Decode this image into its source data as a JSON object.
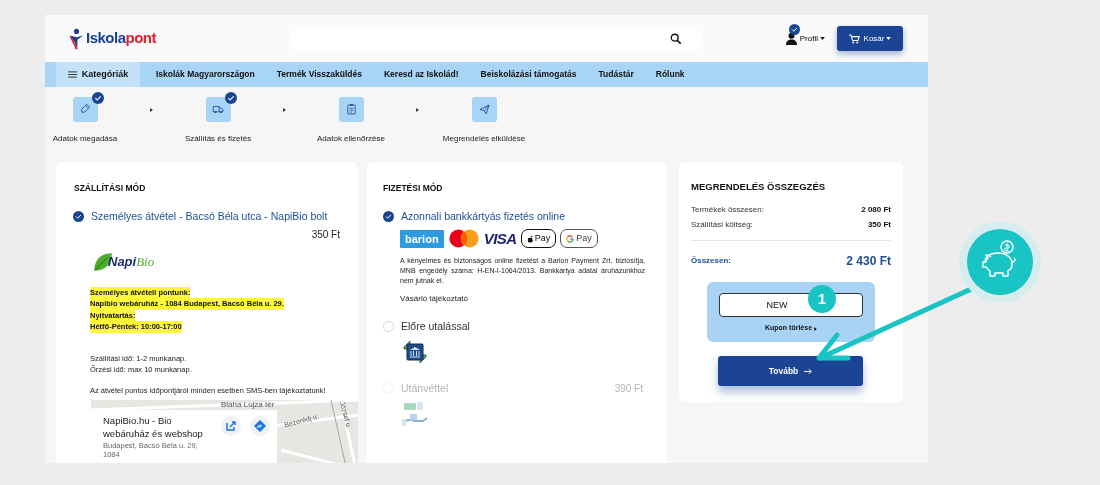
{
  "header": {
    "logo": {
      "first": "Iskola",
      "second": "pont"
    },
    "profile": {
      "label": "Profil",
      "checked": true
    },
    "cart": {
      "label": "Kosár"
    }
  },
  "nav": [
    {
      "label": "Kategóriák",
      "kind": "menu"
    },
    {
      "label": "Iskolák Magyarországon",
      "kind": "link"
    },
    {
      "label": "Termék Visszaküldés",
      "kind": "link"
    },
    {
      "label": "Keresd az Iskolád!",
      "kind": "link"
    },
    {
      "label": "Beiskolázási támogatás",
      "kind": "link"
    },
    {
      "label": "Tudástár",
      "kind": "link"
    },
    {
      "label": "Rólunk",
      "kind": "link"
    }
  ],
  "steps": [
    {
      "label": "Adatok megadása",
      "kind": "edit",
      "done": true
    },
    {
      "label": "Szállítás és fizetés",
      "kind": "truck",
      "done": true
    },
    {
      "label": "Adatok ellenőrzése",
      "kind": "clipboard",
      "done": false
    },
    {
      "label": "Megrendelés elküldése",
      "kind": "send",
      "done": false
    }
  ],
  "shipping": {
    "title": "SZÁLLÍTÁSI MÓD",
    "option": {
      "label": "Személyes átvétel - Bacsó Béla utca - NapiBio bolt",
      "selected": true,
      "price": "350 Ft"
    },
    "store_logo": {
      "first": "Napi",
      "second": "Bio"
    },
    "highlight_lines": [
      "Személyes átvételi pontunk:",
      "Napibio webáruház - 1084 Budapest, Bacsó Béla u. 29.",
      "Nyitvatartás:",
      "Hétfő-Péntek: 10:00-17:00"
    ],
    "info_lines": [
      "Szállítási idő: 1-2 munkanap.",
      "Őrzési idő: max 10 munkanap."
    ],
    "notice": "Az átvétel pontos időpontjáról minden esetben SMS-ben tájékoztatunk!",
    "map": {
      "place_title": "NapiBio.hu - Bio webáruház és webshop",
      "address": "Budapest, Bacsó Béla u. 29, 1084",
      "street_labels": [
        "Blaha Lujza tér",
        "Bezerédj u.",
        "József u."
      ]
    }
  },
  "payment": {
    "title": "FIZETÉSI MÓD",
    "options": [
      {
        "kind": "card",
        "label": "Azonnali bankkártyás fizetés online",
        "selected": true,
        "disabled": false,
        "logos": [
          {
            "kind": "barion",
            "text": "barion"
          },
          {
            "kind": "mastercard"
          },
          {
            "kind": "visa",
            "text": "VISA"
          },
          {
            "kind": "applepay",
            "text": "Pay"
          },
          {
            "kind": "gpay",
            "text": "Pay"
          }
        ],
        "description": "A kényelmes és biztonságos online fizetést a Barion Payment Zrt. biztosítja, MNB engedély száma: H-EN-I-1064/2013. Bankkártya adatai áruházunkhoz nem jutnak el.",
        "link": "Vásárló tájékoztató"
      },
      {
        "kind": "bank",
        "label": "Előre utalással",
        "selected": false,
        "disabled": false
      },
      {
        "kind": "cash",
        "label": "Utánvéttel",
        "selected": false,
        "disabled": true,
        "price": "390 Ft"
      }
    ]
  },
  "summary": {
    "title": "MEGRENDELÉS ÖSSZEGZÉS",
    "rows": [
      {
        "label": "Termékek összesen:",
        "value": "2 080 Ft"
      },
      {
        "label": "Szállítási költség:",
        "value": "350 Ft"
      }
    ],
    "total": {
      "label": "Összesen:",
      "value": "2 430 Ft"
    },
    "coupon": {
      "value": "NEW",
      "remove": "Kupon törlése"
    },
    "next_button": "Tovább"
  },
  "annotation": {
    "badge": "1"
  }
}
